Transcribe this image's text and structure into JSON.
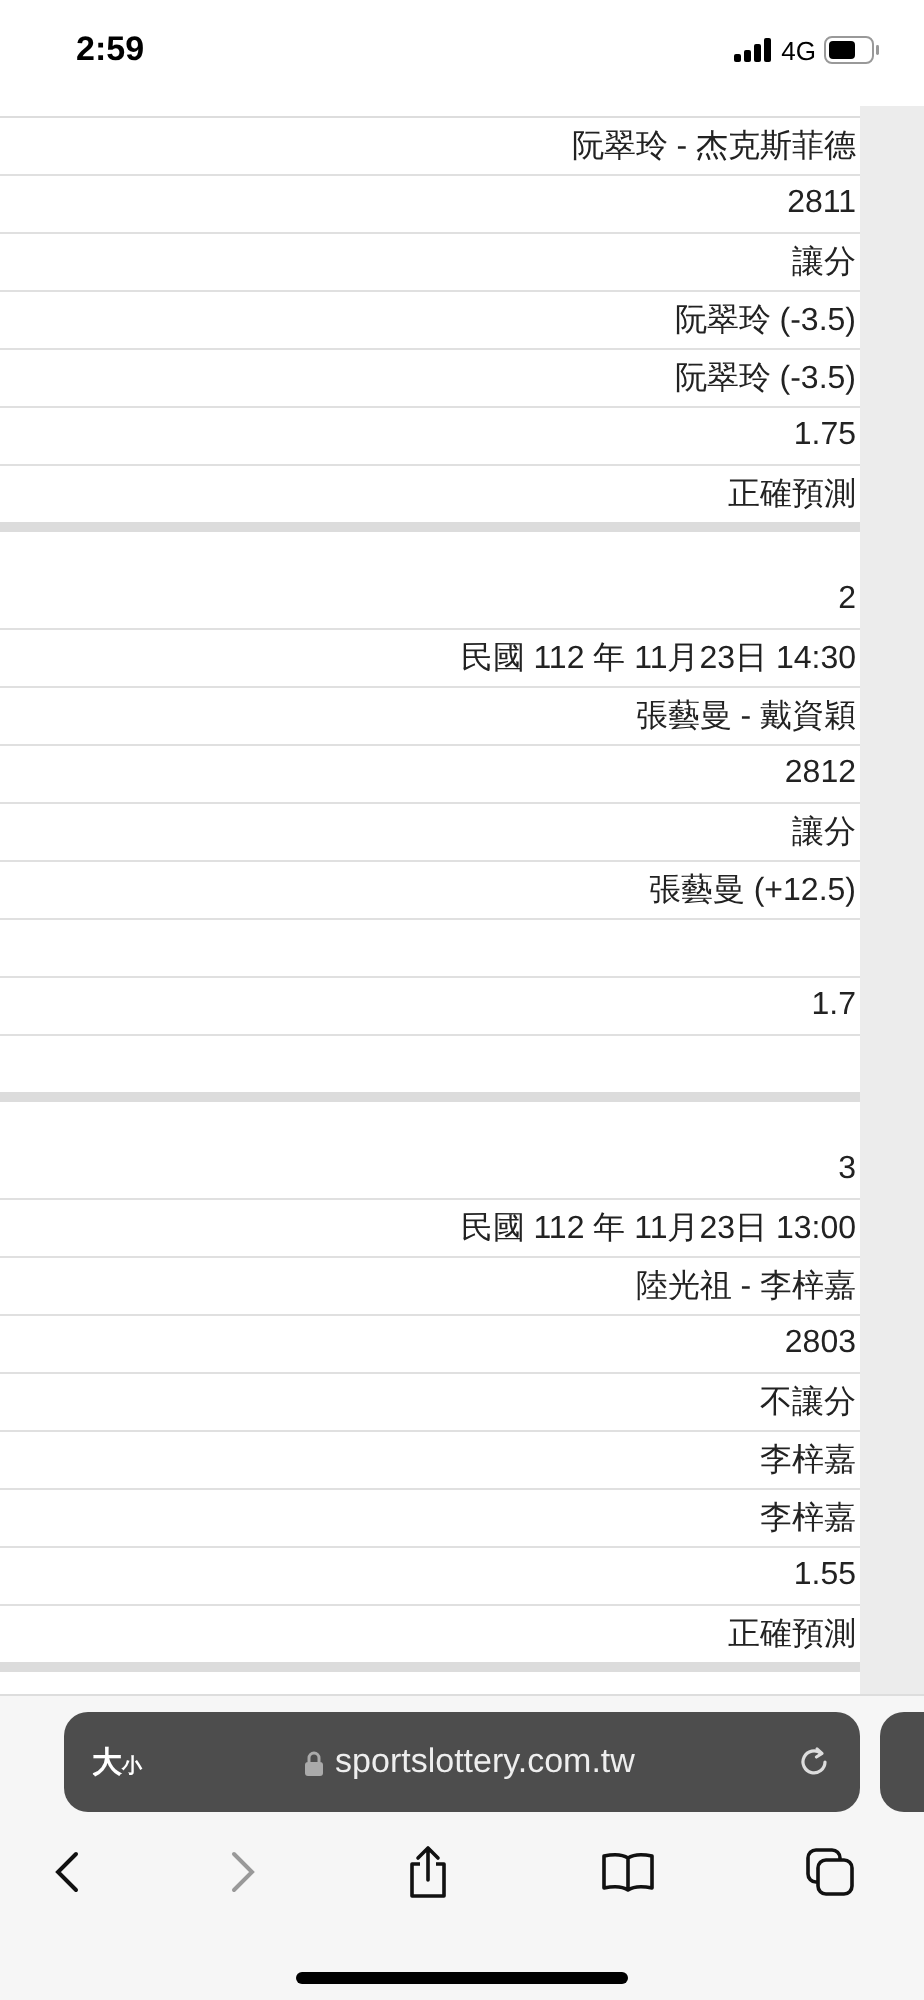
{
  "status_bar": {
    "time": "2:59",
    "network": "4G"
  },
  "sections": [
    {
      "rows": [
        {
          "kind": "text",
          "text": "阮翠玲 - 杰克斯菲德"
        },
        {
          "kind": "text",
          "text": "2811"
        },
        {
          "kind": "text",
          "text": "讓分"
        },
        {
          "kind": "text",
          "text": "阮翠玲 (-3.5)"
        },
        {
          "kind": "text",
          "text": "阮翠玲 (-3.5)"
        },
        {
          "kind": "text",
          "text": "1.75"
        },
        {
          "kind": "text",
          "text": "正確預測"
        }
      ]
    },
    {
      "rows": [
        {
          "kind": "text",
          "text": "2"
        },
        {
          "kind": "text",
          "text": "民國 112 年 11月23日 14:30"
        },
        {
          "kind": "text",
          "text": "張藝曼 - 戴資穎"
        },
        {
          "kind": "text",
          "text": "2812"
        },
        {
          "kind": "text",
          "text": "讓分"
        },
        {
          "kind": "text",
          "text": "張藝曼 (+12.5)"
        },
        {
          "kind": "empty"
        },
        {
          "kind": "text",
          "text": "1.7"
        },
        {
          "kind": "empty"
        }
      ]
    },
    {
      "rows": [
        {
          "kind": "text",
          "text": "3"
        },
        {
          "kind": "text",
          "text": "民國 112 年 11月23日 13:00"
        },
        {
          "kind": "text",
          "text": "陸光祖 - 李梓嘉"
        },
        {
          "kind": "text",
          "text": "2803"
        },
        {
          "kind": "text",
          "text": "不讓分"
        },
        {
          "kind": "text",
          "text": "李梓嘉"
        },
        {
          "kind": "text",
          "text": "李梓嘉"
        },
        {
          "kind": "text",
          "text": "1.55"
        },
        {
          "kind": "text",
          "text": "正確預測"
        }
      ]
    }
  ],
  "browser": {
    "text_size_large": "大",
    "text_size_small": "小",
    "url": "sportslottery.com.tw"
  }
}
